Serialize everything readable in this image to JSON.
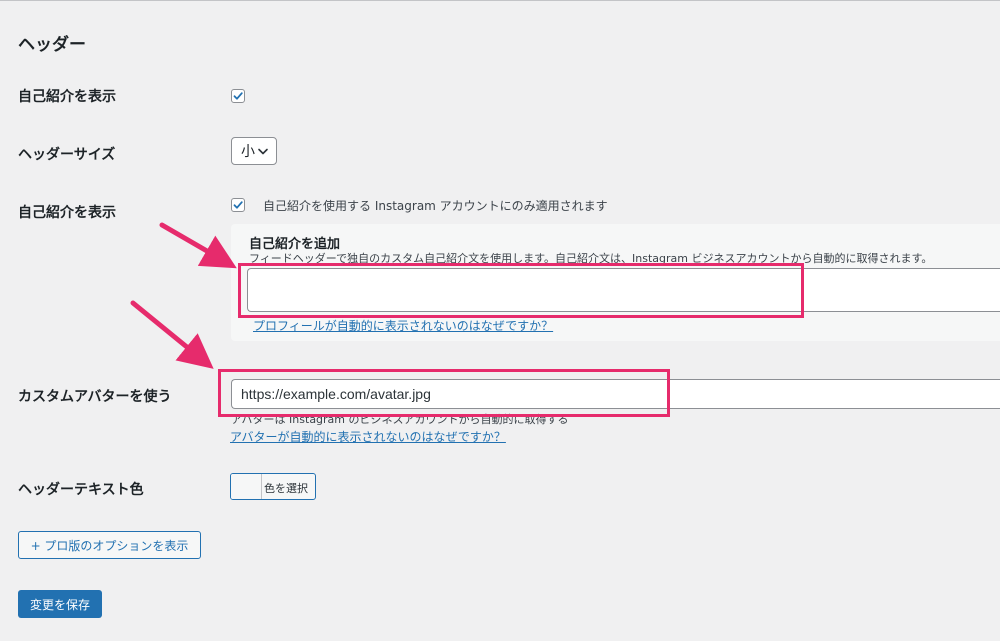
{
  "section": {
    "title": "ヘッダー"
  },
  "rows": {
    "show_bio": {
      "label": "自己紹介を表示",
      "checked": true
    },
    "header_size": {
      "label": "ヘッダーサイズ",
      "selected": "小"
    },
    "show_bio_2": {
      "label": "自己紹介を表示",
      "checked": true,
      "note": "自己紹介を使用する Instagram アカウントにのみ適用されます"
    },
    "custom_avatar": {
      "label": "カスタムアバターを使う",
      "value": "https://example.com/avatar.jpg",
      "desc": "アバターは Instagram のビジネスアカウントから自動的に取得する",
      "help_link": "アバターが自動的に表示されないのはなぜですか？"
    },
    "header_text_color": {
      "label": "ヘッダーテキスト色",
      "button_label": "色を選択"
    }
  },
  "bio_panel": {
    "title": "自己紹介を追加",
    "desc": "フィードヘッダーで独自のカスタム自己紹介文を使用します。自己紹介文は、Instagram ビジネスアカウントから自動的に取得されます。",
    "textarea_value": "",
    "help_link": "プロフィールが自動的に表示されないのはなぜですか？"
  },
  "buttons": {
    "pro_options": "+ プロ版のオプションを表示",
    "save": "変更を保存"
  },
  "colors": {
    "accent": "#2271b1",
    "highlight": "#e62b6c",
    "background": "#f0f0f1"
  }
}
